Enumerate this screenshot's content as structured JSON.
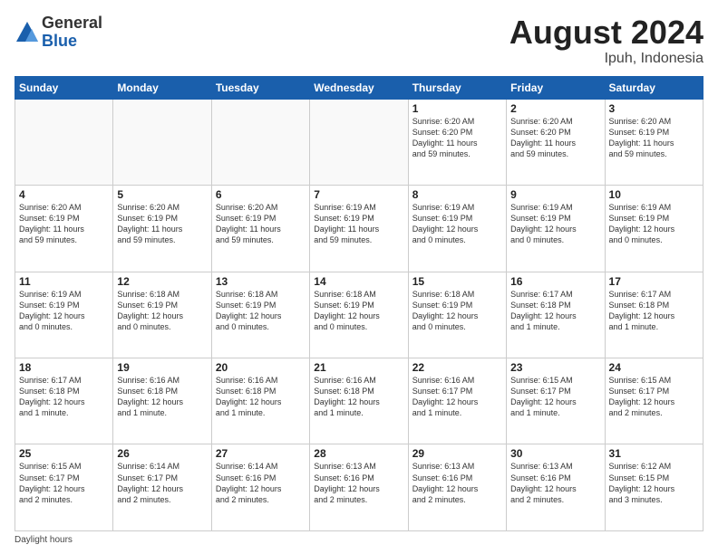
{
  "header": {
    "logo_general": "General",
    "logo_blue": "Blue",
    "title": "August 2024",
    "location": "Ipuh, Indonesia"
  },
  "footer": {
    "note": "Daylight hours"
  },
  "days_of_week": [
    "Sunday",
    "Monday",
    "Tuesday",
    "Wednesday",
    "Thursday",
    "Friday",
    "Saturday"
  ],
  "weeks": [
    [
      {
        "day": "",
        "info": "",
        "empty": true
      },
      {
        "day": "",
        "info": "",
        "empty": true
      },
      {
        "day": "",
        "info": "",
        "empty": true
      },
      {
        "day": "",
        "info": "",
        "empty": true
      },
      {
        "day": "1",
        "info": "Sunrise: 6:20 AM\nSunset: 6:20 PM\nDaylight: 11 hours\nand 59 minutes."
      },
      {
        "day": "2",
        "info": "Sunrise: 6:20 AM\nSunset: 6:20 PM\nDaylight: 11 hours\nand 59 minutes."
      },
      {
        "day": "3",
        "info": "Sunrise: 6:20 AM\nSunset: 6:19 PM\nDaylight: 11 hours\nand 59 minutes."
      }
    ],
    [
      {
        "day": "4",
        "info": "Sunrise: 6:20 AM\nSunset: 6:19 PM\nDaylight: 11 hours\nand 59 minutes."
      },
      {
        "day": "5",
        "info": "Sunrise: 6:20 AM\nSunset: 6:19 PM\nDaylight: 11 hours\nand 59 minutes."
      },
      {
        "day": "6",
        "info": "Sunrise: 6:20 AM\nSunset: 6:19 PM\nDaylight: 11 hours\nand 59 minutes."
      },
      {
        "day": "7",
        "info": "Sunrise: 6:19 AM\nSunset: 6:19 PM\nDaylight: 11 hours\nand 59 minutes."
      },
      {
        "day": "8",
        "info": "Sunrise: 6:19 AM\nSunset: 6:19 PM\nDaylight: 12 hours\nand 0 minutes."
      },
      {
        "day": "9",
        "info": "Sunrise: 6:19 AM\nSunset: 6:19 PM\nDaylight: 12 hours\nand 0 minutes."
      },
      {
        "day": "10",
        "info": "Sunrise: 6:19 AM\nSunset: 6:19 PM\nDaylight: 12 hours\nand 0 minutes."
      }
    ],
    [
      {
        "day": "11",
        "info": "Sunrise: 6:19 AM\nSunset: 6:19 PM\nDaylight: 12 hours\nand 0 minutes."
      },
      {
        "day": "12",
        "info": "Sunrise: 6:18 AM\nSunset: 6:19 PM\nDaylight: 12 hours\nand 0 minutes."
      },
      {
        "day": "13",
        "info": "Sunrise: 6:18 AM\nSunset: 6:19 PM\nDaylight: 12 hours\nand 0 minutes."
      },
      {
        "day": "14",
        "info": "Sunrise: 6:18 AM\nSunset: 6:19 PM\nDaylight: 12 hours\nand 0 minutes."
      },
      {
        "day": "15",
        "info": "Sunrise: 6:18 AM\nSunset: 6:19 PM\nDaylight: 12 hours\nand 0 minutes."
      },
      {
        "day": "16",
        "info": "Sunrise: 6:17 AM\nSunset: 6:18 PM\nDaylight: 12 hours\nand 1 minute."
      },
      {
        "day": "17",
        "info": "Sunrise: 6:17 AM\nSunset: 6:18 PM\nDaylight: 12 hours\nand 1 minute."
      }
    ],
    [
      {
        "day": "18",
        "info": "Sunrise: 6:17 AM\nSunset: 6:18 PM\nDaylight: 12 hours\nand 1 minute."
      },
      {
        "day": "19",
        "info": "Sunrise: 6:16 AM\nSunset: 6:18 PM\nDaylight: 12 hours\nand 1 minute."
      },
      {
        "day": "20",
        "info": "Sunrise: 6:16 AM\nSunset: 6:18 PM\nDaylight: 12 hours\nand 1 minute."
      },
      {
        "day": "21",
        "info": "Sunrise: 6:16 AM\nSunset: 6:18 PM\nDaylight: 12 hours\nand 1 minute."
      },
      {
        "day": "22",
        "info": "Sunrise: 6:16 AM\nSunset: 6:17 PM\nDaylight: 12 hours\nand 1 minute."
      },
      {
        "day": "23",
        "info": "Sunrise: 6:15 AM\nSunset: 6:17 PM\nDaylight: 12 hours\nand 1 minute."
      },
      {
        "day": "24",
        "info": "Sunrise: 6:15 AM\nSunset: 6:17 PM\nDaylight: 12 hours\nand 2 minutes."
      }
    ],
    [
      {
        "day": "25",
        "info": "Sunrise: 6:15 AM\nSunset: 6:17 PM\nDaylight: 12 hours\nand 2 minutes."
      },
      {
        "day": "26",
        "info": "Sunrise: 6:14 AM\nSunset: 6:17 PM\nDaylight: 12 hours\nand 2 minutes."
      },
      {
        "day": "27",
        "info": "Sunrise: 6:14 AM\nSunset: 6:16 PM\nDaylight: 12 hours\nand 2 minutes."
      },
      {
        "day": "28",
        "info": "Sunrise: 6:13 AM\nSunset: 6:16 PM\nDaylight: 12 hours\nand 2 minutes."
      },
      {
        "day": "29",
        "info": "Sunrise: 6:13 AM\nSunset: 6:16 PM\nDaylight: 12 hours\nand 2 minutes."
      },
      {
        "day": "30",
        "info": "Sunrise: 6:13 AM\nSunset: 6:16 PM\nDaylight: 12 hours\nand 2 minutes."
      },
      {
        "day": "31",
        "info": "Sunrise: 6:12 AM\nSunset: 6:15 PM\nDaylight: 12 hours\nand 3 minutes."
      }
    ]
  ]
}
